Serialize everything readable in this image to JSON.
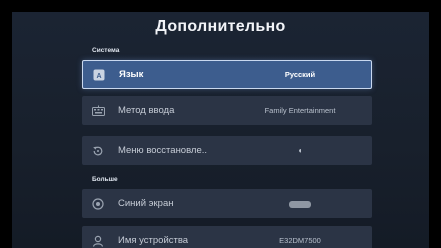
{
  "title": "Дополнительно",
  "sections": {
    "system": "Система",
    "more": "Больше"
  },
  "rows": [
    {
      "label": "Язык",
      "value": "Русский",
      "icon": "language-icon"
    },
    {
      "label": "Метод ввода",
      "value": "Family Entertainment",
      "icon": "keyboard-icon"
    },
    {
      "label": "Меню восстановле..",
      "value": "",
      "icon": "restore-icon"
    },
    {
      "label": "Синий экран",
      "value": "",
      "icon": "blue-screen-icon"
    },
    {
      "label": "Имя устройства",
      "value": "E32DM7500",
      "icon": "device-user-icon"
    }
  ],
  "colors": {
    "panel": "#1b2433",
    "row": "#2b3445",
    "focused_row": "#3d5d8e",
    "focus_border": "#c9d8ef"
  }
}
